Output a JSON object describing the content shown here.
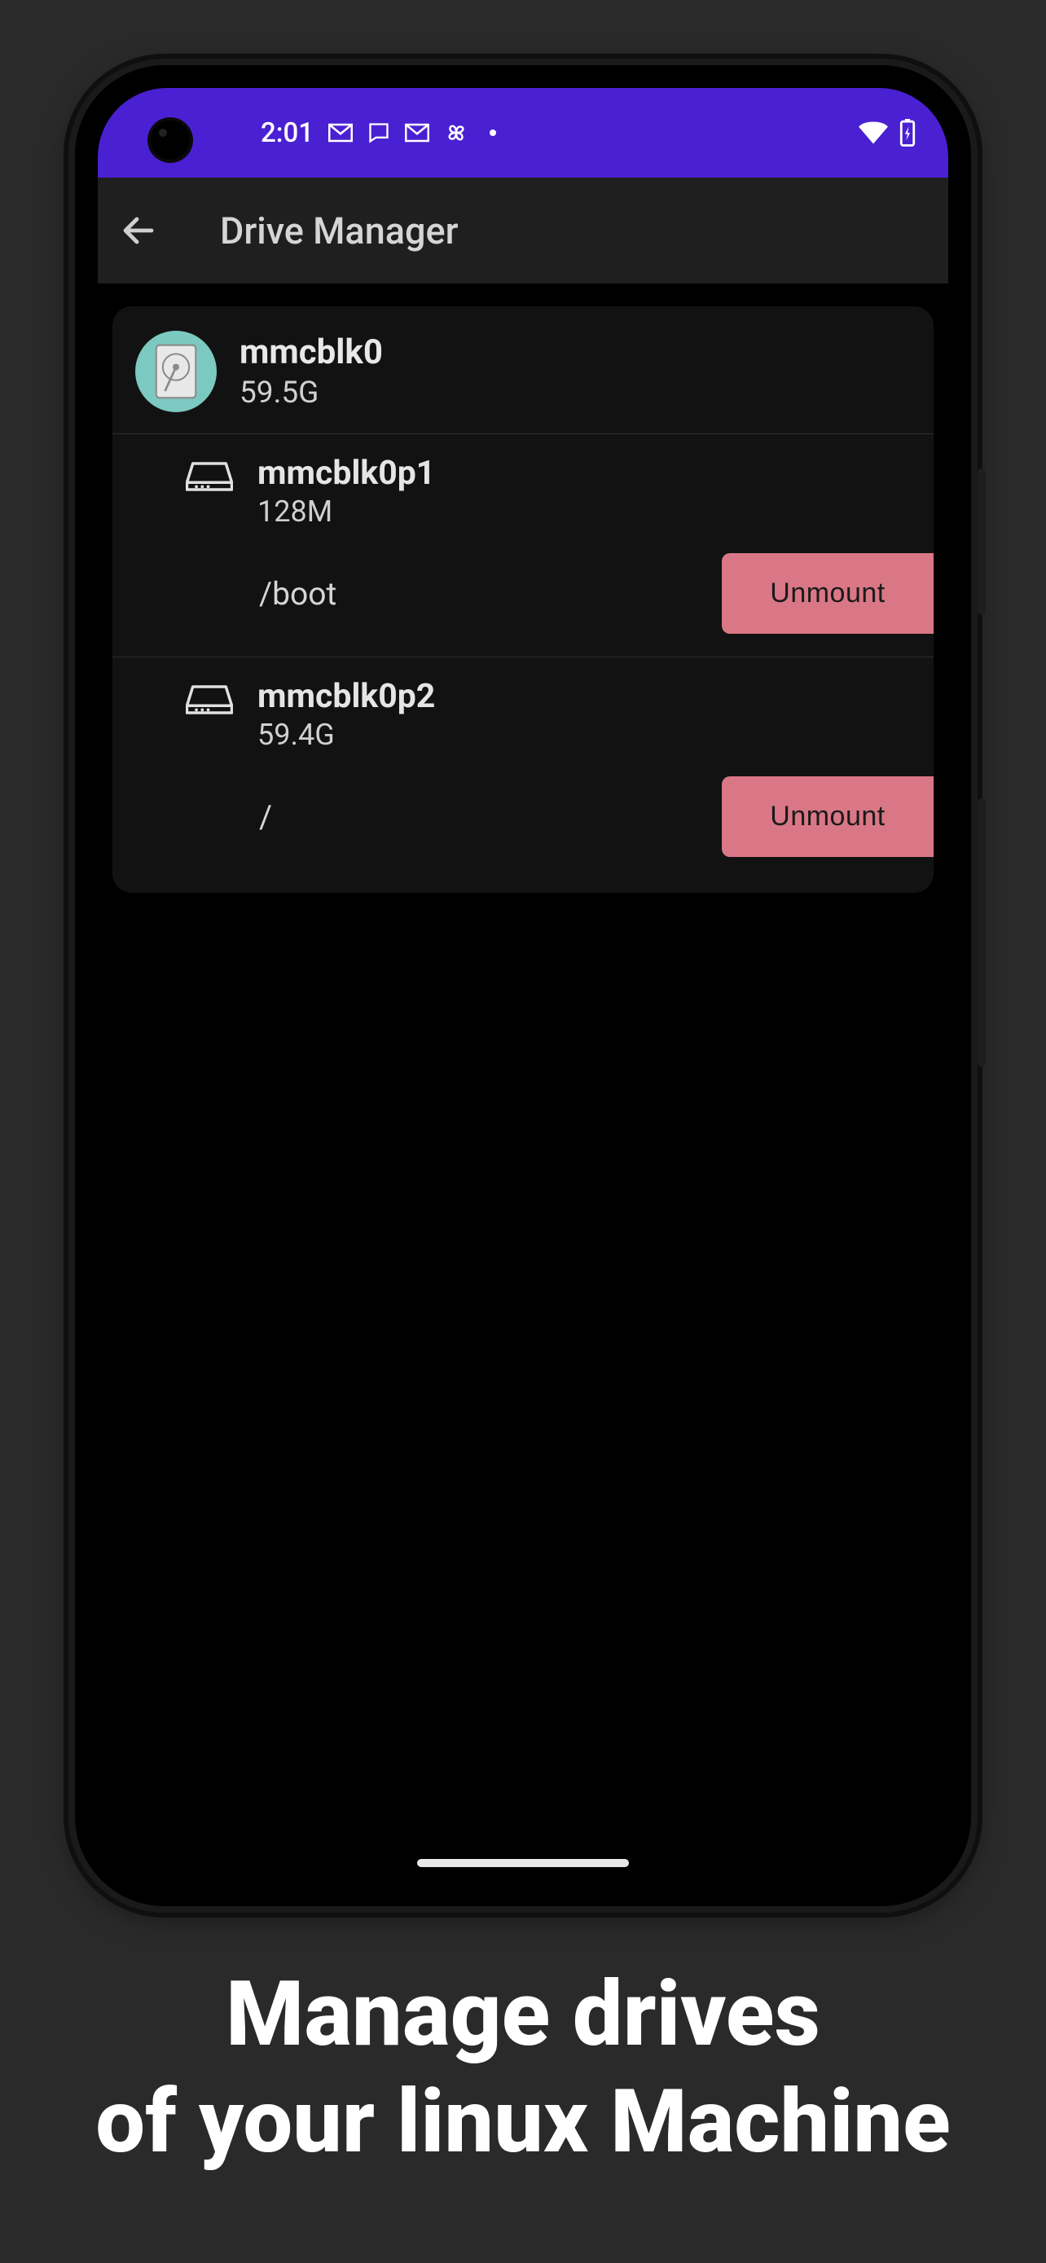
{
  "status": {
    "time": "2:01",
    "icons": [
      "gmail-icon",
      "messages-icon",
      "gmail-icon",
      "pinwheel-icon"
    ],
    "right_icons": [
      "wifi-icon",
      "battery-charging-icon"
    ]
  },
  "appbar": {
    "title": "Drive Manager",
    "back_icon": "back-arrow-icon"
  },
  "drive": {
    "name": "mmcblk0",
    "size": "59.5G",
    "avatar_icon": "hdd-icon",
    "partitions": [
      {
        "name": "mmcblk0p1",
        "size": "128M",
        "mount": "/boot",
        "action_label": "Unmount",
        "icon": "drive-icon"
      },
      {
        "name": "mmcblk0p2",
        "size": "59.4G",
        "mount": "/",
        "action_label": "Unmount",
        "icon": "drive-icon"
      }
    ]
  },
  "promo": {
    "line1": "Manage drives",
    "line2": "of your linux Machine"
  }
}
